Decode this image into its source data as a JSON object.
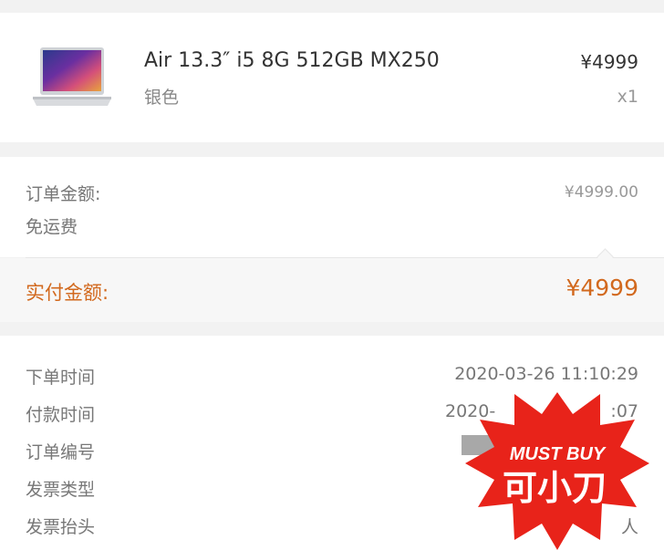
{
  "product": {
    "name": "Air 13.3″ i5 8G  512GB MX250",
    "variant": "银色",
    "price": "¥4999",
    "quantity": "x1",
    "thumbnail_icon": "laptop-icon"
  },
  "summary": {
    "order_amount_label": "订单金额:",
    "order_amount_value": "¥4999.00",
    "shipping_label": "免运费"
  },
  "paid": {
    "label": "实付金额:",
    "value": "¥4999",
    "accent_color": "#d2691e"
  },
  "details": {
    "rows": [
      {
        "label": "下单时间",
        "value": "2020-03-26 11:10:29"
      },
      {
        "label": "付款时间",
        "value": "2020-"
      },
      {
        "label": "订单编号",
        "value": ""
      },
      {
        "label": "发票类型",
        "value": ""
      },
      {
        "label": "发票抬头",
        "value": "人"
      }
    ],
    "payment_time_tail": ":07"
  },
  "watermark": {
    "line1": "MUST BUY",
    "line2": "可小刀",
    "color": "#e8231a"
  }
}
